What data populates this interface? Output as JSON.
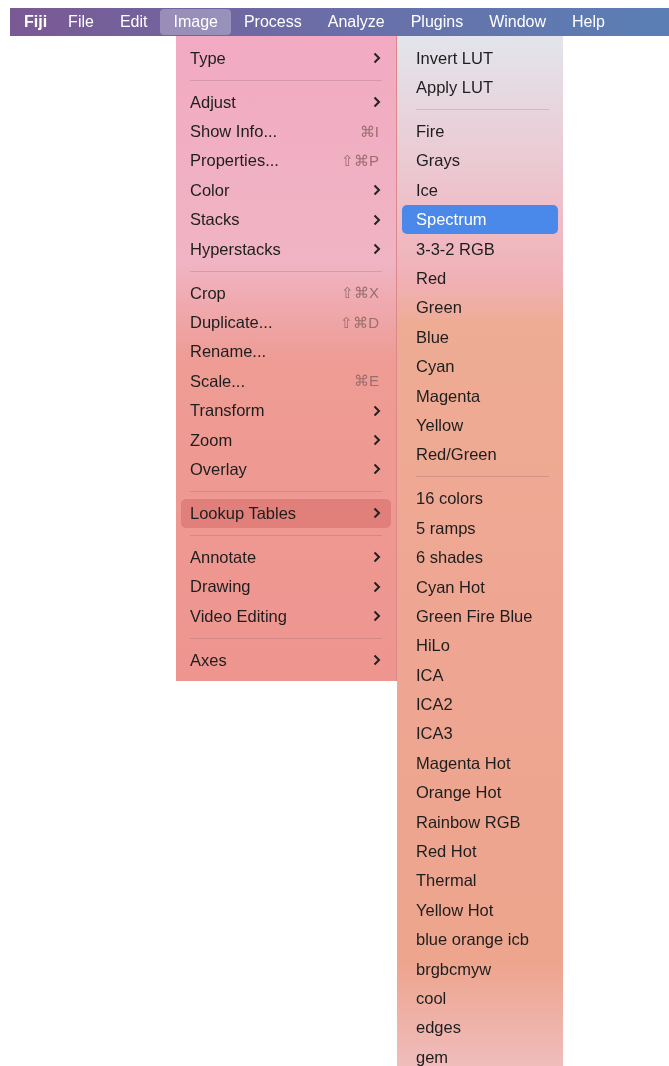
{
  "menu_bar": [
    {
      "label": "Fiji",
      "kind": "app",
      "selected": false
    },
    {
      "label": "File",
      "kind": "menu",
      "selected": false
    },
    {
      "label": "Edit",
      "kind": "menu",
      "selected": false
    },
    {
      "label": "Image",
      "kind": "menu",
      "selected": true
    },
    {
      "label": "Process",
      "kind": "menu",
      "selected": false
    },
    {
      "label": "Analyze",
      "kind": "menu",
      "selected": false
    },
    {
      "label": "Plugins",
      "kind": "menu",
      "selected": false
    },
    {
      "label": "Window",
      "kind": "menu",
      "selected": false
    },
    {
      "label": "Help",
      "kind": "menu",
      "selected": false
    }
  ],
  "image_menu": [
    {
      "kind": "item",
      "label": "Type",
      "submenu": true,
      "selected": false
    },
    {
      "kind": "separator"
    },
    {
      "kind": "item",
      "label": "Adjust",
      "submenu": true,
      "selected": false
    },
    {
      "kind": "item",
      "label": "Show Info...",
      "shortcut": "⌘I",
      "submenu": false,
      "selected": false
    },
    {
      "kind": "item",
      "label": "Properties...",
      "shortcut": "⇧⌘P",
      "submenu": false,
      "selected": false
    },
    {
      "kind": "item",
      "label": "Color",
      "submenu": true,
      "selected": false
    },
    {
      "kind": "item",
      "label": "Stacks",
      "submenu": true,
      "selected": false
    },
    {
      "kind": "item",
      "label": "Hyperstacks",
      "submenu": true,
      "selected": false
    },
    {
      "kind": "separator"
    },
    {
      "kind": "item",
      "label": "Crop",
      "shortcut": "⇧⌘X",
      "submenu": false,
      "selected": false
    },
    {
      "kind": "item",
      "label": "Duplicate...",
      "shortcut": "⇧⌘D",
      "submenu": false,
      "selected": false
    },
    {
      "kind": "item",
      "label": "Rename...",
      "submenu": false,
      "selected": false
    },
    {
      "kind": "item",
      "label": "Scale...",
      "shortcut": "⌘E",
      "submenu": false,
      "selected": false
    },
    {
      "kind": "item",
      "label": "Transform",
      "submenu": true,
      "selected": false
    },
    {
      "kind": "item",
      "label": "Zoom",
      "submenu": true,
      "selected": false
    },
    {
      "kind": "item",
      "label": "Overlay",
      "submenu": true,
      "selected": false
    },
    {
      "kind": "separator"
    },
    {
      "kind": "item",
      "label": "Lookup Tables",
      "submenu": true,
      "selected": true
    },
    {
      "kind": "separator"
    },
    {
      "kind": "item",
      "label": "Annotate",
      "submenu": true,
      "selected": false
    },
    {
      "kind": "item",
      "label": "Drawing",
      "submenu": true,
      "selected": false
    },
    {
      "kind": "item",
      "label": "Video Editing",
      "submenu": true,
      "selected": false
    },
    {
      "kind": "separator"
    },
    {
      "kind": "item",
      "label": "Axes",
      "submenu": true,
      "selected": false
    }
  ],
  "lookup_tables_menu": [
    {
      "kind": "item",
      "label": "Invert LUT",
      "selected": false
    },
    {
      "kind": "item",
      "label": "Apply LUT",
      "selected": false
    },
    {
      "kind": "separator"
    },
    {
      "kind": "item",
      "label": "Fire",
      "selected": false
    },
    {
      "kind": "item",
      "label": "Grays",
      "selected": false
    },
    {
      "kind": "item",
      "label": "Ice",
      "selected": false
    },
    {
      "kind": "item",
      "label": "Spectrum",
      "selected": true
    },
    {
      "kind": "item",
      "label": "3-3-2 RGB",
      "selected": false
    },
    {
      "kind": "item",
      "label": "Red",
      "selected": false
    },
    {
      "kind": "item",
      "label": "Green",
      "selected": false
    },
    {
      "kind": "item",
      "label": "Blue",
      "selected": false
    },
    {
      "kind": "item",
      "label": "Cyan",
      "selected": false
    },
    {
      "kind": "item",
      "label": "Magenta",
      "selected": false
    },
    {
      "kind": "item",
      "label": "Yellow",
      "selected": false
    },
    {
      "kind": "item",
      "label": "Red/Green",
      "selected": false
    },
    {
      "kind": "separator"
    },
    {
      "kind": "item",
      "label": "16 colors",
      "selected": false
    },
    {
      "kind": "item",
      "label": "5 ramps",
      "selected": false
    },
    {
      "kind": "item",
      "label": "6 shades",
      "selected": false
    },
    {
      "kind": "item",
      "label": "Cyan Hot",
      "selected": false
    },
    {
      "kind": "item",
      "label": "Green Fire Blue",
      "selected": false
    },
    {
      "kind": "item",
      "label": "HiLo",
      "selected": false
    },
    {
      "kind": "item",
      "label": "ICA",
      "selected": false
    },
    {
      "kind": "item",
      "label": "ICA2",
      "selected": false
    },
    {
      "kind": "item",
      "label": "ICA3",
      "selected": false
    },
    {
      "kind": "item",
      "label": "Magenta Hot",
      "selected": false
    },
    {
      "kind": "item",
      "label": "Orange Hot",
      "selected": false
    },
    {
      "kind": "item",
      "label": "Rainbow RGB",
      "selected": false
    },
    {
      "kind": "item",
      "label": "Red Hot",
      "selected": false
    },
    {
      "kind": "item",
      "label": "Thermal",
      "selected": false
    },
    {
      "kind": "item",
      "label": "Yellow Hot",
      "selected": false
    },
    {
      "kind": "item",
      "label": "blue orange icb",
      "selected": false
    },
    {
      "kind": "item",
      "label": "brgbcmyw",
      "selected": false
    },
    {
      "kind": "item",
      "label": "cool",
      "selected": false
    },
    {
      "kind": "item",
      "label": "edges",
      "selected": false
    },
    {
      "kind": "item",
      "label": "gem",
      "selected": false
    }
  ]
}
